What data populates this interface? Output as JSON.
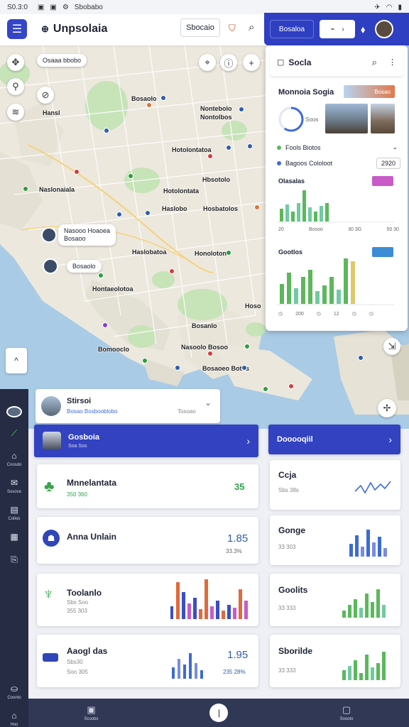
{
  "status": {
    "time": "S0.3:0",
    "carrier": "Sbobabo"
  },
  "header": {
    "title": "Unpsolaia",
    "search_label": "Sbocaio"
  },
  "panel_header": {
    "button_label": "Bosaloa"
  },
  "map": {
    "chip_top": "Osaaa bbobo",
    "labels": [
      "Bosaolo",
      "Hansl",
      "Nontebolo",
      "Nontolbos",
      "Hotolontatoa",
      "Hbsotolo",
      "Hotolontata",
      "Naslonaiala",
      "Haslobo",
      "Hosbatolos",
      "Haslobatoa",
      "Honoloton",
      "Hontaeolotoa",
      "Bosanlo",
      "Bomooclo",
      "Nasoolo Bosoo",
      "Bosaoeo Botos",
      "Hoso"
    ],
    "bubble1": "Nasooo Hoaoea",
    "bubble1_sub": "Bosaoo",
    "bubble2": "Bosaolo"
  },
  "side_panel": {
    "title": "Socla",
    "section_title": "Monnoia Sogia",
    "badge": "Bosao",
    "gauge_label": "Soos",
    "legend1": "Fools Biotos",
    "legend2": "Bagoos Cololoot",
    "legend2_value": "2920",
    "chart1_title": "Olasalas",
    "chart1_badge": "",
    "chart1_ticks": [
      "20",
      "Bosoo",
      "30 3G",
      "50 30"
    ],
    "chart2_title": "Gootlos",
    "chart2_badge": "",
    "chart2_ticks": [
      "200",
      "12"
    ],
    "colors": {
      "green": "#5bb85c",
      "teal": "#6fcba0",
      "pink": "#e05bb0",
      "blue": "#3b6bd6",
      "yellow": "#e0c86a"
    }
  },
  "sidebar": {
    "items": [
      {
        "label": ""
      },
      {
        "label": ""
      },
      {
        "label": "Coosdo"
      },
      {
        "label": "Sosoce"
      },
      {
        "label": "Colloo"
      },
      {
        "label": ""
      },
      {
        "label": ""
      }
    ],
    "bottom_label": "Coonto",
    "home_label": "Hoo"
  },
  "search_card": {
    "title": "Stirsoi",
    "sub": "Bosao Bosbooblobo",
    "sub2": "Tosoao"
  },
  "blue_card_left": {
    "title": "Gosboia",
    "sub": "Soa Sos"
  },
  "blue_card_right": {
    "title": "Dooooqiil"
  },
  "list_cards": [
    {
      "title": "Mnnelantata",
      "sub": "350 360",
      "value": "35",
      "value_color": "#2ea44f"
    },
    {
      "title": "Anna Unlain",
      "sub": "",
      "value": "1.85",
      "value2": "33.3%",
      "value_color": "#2f5dae"
    },
    {
      "title": "Toolanlo",
      "sub": "Sbs Soo",
      "sub2": "355 303",
      "value": ""
    },
    {
      "title": "Aaogl das",
      "sub": "Sbs30",
      "sub2": "Soo 305",
      "value": "1.95",
      "value2": "235 28%",
      "value_color": "#2f5dae"
    }
  ],
  "right_cards": [
    {
      "title": "Ccja",
      "sub": "Sbs 38s"
    },
    {
      "title": "Gonge",
      "sub": "33 303"
    },
    {
      "title": "Goolits",
      "sub": "33 333"
    },
    {
      "title": "Sborilde",
      "sub": "33 333"
    }
  ],
  "bottom_bar": {
    "item1": "Scoobs",
    "item3": "Soooto"
  }
}
